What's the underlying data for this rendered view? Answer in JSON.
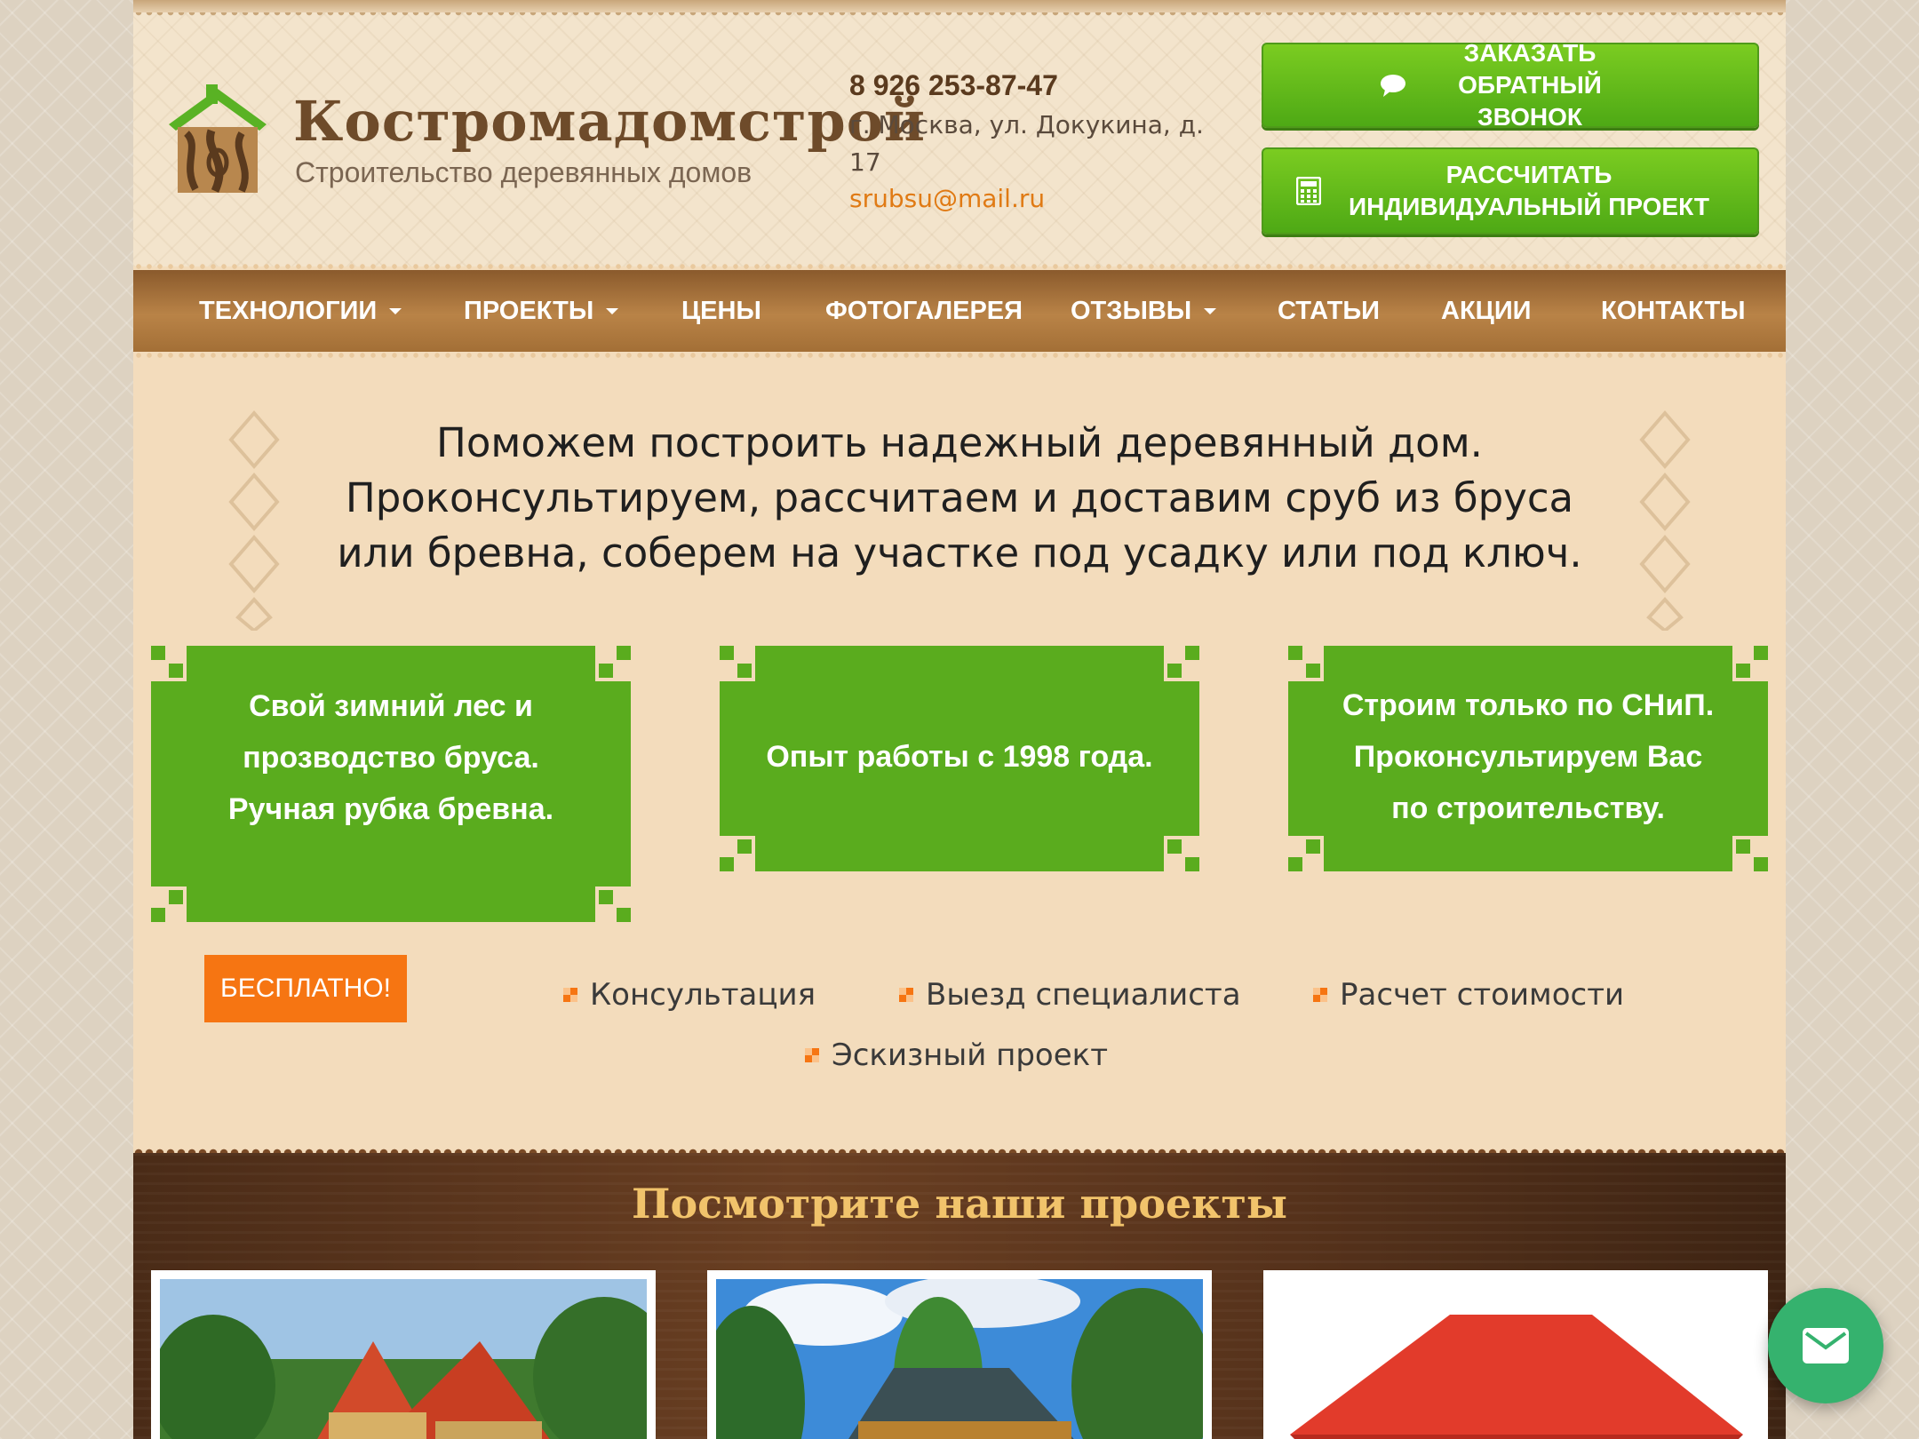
{
  "header": {
    "logo_title": "Костромадомстрой",
    "logo_subtitle": "Строительство деревянных домов",
    "phone": "8 926 253-87-47",
    "address": "г. Москва, ул. Докукина, д. 17",
    "email": "srubsu@mail.ru",
    "callback_button": "ЗАКАЗАТЬ ОБРАТНЫЙ ЗВОНОК",
    "calc_button": "РАССЧИТАТЬ ИНДИВИДУАЛЬНЫЙ ПРОЕКТ"
  },
  "nav": {
    "items": [
      {
        "label": "ТЕХНОЛОГИИ",
        "has_dropdown": true
      },
      {
        "label": "ПРОЕКТЫ",
        "has_dropdown": true
      },
      {
        "label": "ЦЕНЫ",
        "has_dropdown": false
      },
      {
        "label": "ФОТОГАЛЕРЕЯ",
        "has_dropdown": false
      },
      {
        "label": "ОТЗЫВЫ",
        "has_dropdown": true
      },
      {
        "label": "СТАТЬИ",
        "has_dropdown": false
      },
      {
        "label": "АКЦИИ",
        "has_dropdown": false
      },
      {
        "label": "КОНТАКТЫ",
        "has_dropdown": false
      }
    ]
  },
  "intro": {
    "line1": "Поможем построить надежный деревянный дом.",
    "line2": "Проконсультируем, рассчитаем и доставим сруб из бруса",
    "line3": "или бревна, соберем на участке под усадку или под ключ."
  },
  "features": [
    {
      "line1": "Свой зимний лес и",
      "line2": "прозводство бруса.",
      "line3": "Ручная рубка бревна."
    },
    {
      "line1": "Опыт работы с 1998 года."
    },
    {
      "line1": "Строим только по СНиП.",
      "line2": "Проконсультируем Вас",
      "line3": "по строительству."
    }
  ],
  "free": {
    "badge": "БЕСПЛАТНО!",
    "services": [
      "Консультация",
      "Выезд специалиста",
      "Расчет стоимости",
      "Эскизный проект"
    ]
  },
  "projects": {
    "title": "Посмотрите наши проекты"
  },
  "icons": {
    "chat": "chat-bubble-icon",
    "calculator": "calculator-icon",
    "mail": "mail-icon"
  },
  "colors": {
    "green": "#5aac1e",
    "orange": "#f67512",
    "brown_nav": "#a36f36",
    "gold_title": "#f1c36b",
    "fab": "#35b26e"
  }
}
